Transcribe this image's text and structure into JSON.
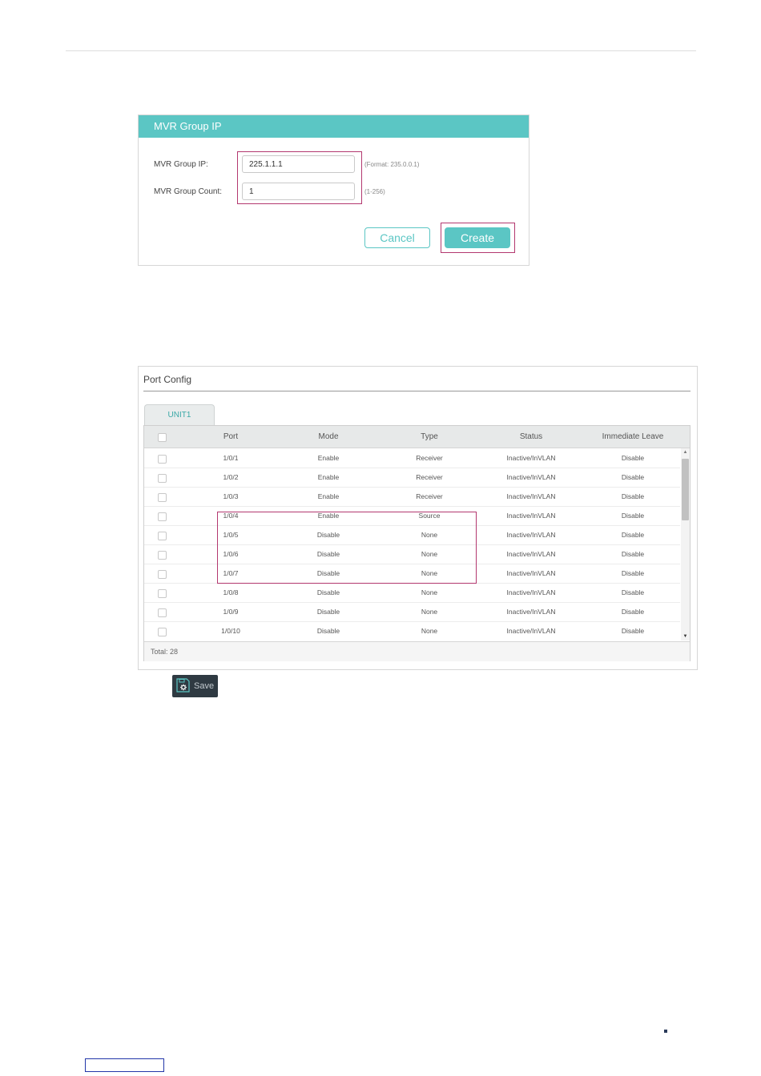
{
  "mvr_panel": {
    "title": "MVR Group IP",
    "fields": [
      {
        "label": "MVR Group IP:",
        "value": "225.1.1.1",
        "hint": "(Format: 235.0.0.1)"
      },
      {
        "label": "MVR Group Count:",
        "value": "1",
        "hint": "(1-256)"
      }
    ],
    "cancel_label": "Cancel",
    "create_label": "Create"
  },
  "port_config": {
    "title": "Port Config",
    "tab": "UNIT1",
    "columns": [
      "Port",
      "Mode",
      "Type",
      "Status",
      "Immediate Leave"
    ],
    "rows": [
      {
        "port": "1/0/1",
        "mode": "Enable",
        "type": "Receiver",
        "status": "Inactive/InVLAN",
        "leave": "Disable"
      },
      {
        "port": "1/0/2",
        "mode": "Enable",
        "type": "Receiver",
        "status": "Inactive/InVLAN",
        "leave": "Disable"
      },
      {
        "port": "1/0/3",
        "mode": "Enable",
        "type": "Receiver",
        "status": "Inactive/InVLAN",
        "leave": "Disable"
      },
      {
        "port": "1/0/4",
        "mode": "Enable",
        "type": "Source",
        "status": "Inactive/InVLAN",
        "leave": "Disable"
      },
      {
        "port": "1/0/5",
        "mode": "Disable",
        "type": "None",
        "status": "Inactive/InVLAN",
        "leave": "Disable"
      },
      {
        "port": "1/0/6",
        "mode": "Disable",
        "type": "None",
        "status": "Inactive/InVLAN",
        "leave": "Disable"
      },
      {
        "port": "1/0/7",
        "mode": "Disable",
        "type": "None",
        "status": "Inactive/InVLAN",
        "leave": "Disable"
      },
      {
        "port": "1/0/8",
        "mode": "Disable",
        "type": "None",
        "status": "Inactive/InVLAN",
        "leave": "Disable"
      },
      {
        "port": "1/0/9",
        "mode": "Disable",
        "type": "None",
        "status": "Inactive/InVLAN",
        "leave": "Disable"
      },
      {
        "port": "1/0/10",
        "mode": "Disable",
        "type": "None",
        "status": "Inactive/InVLAN",
        "leave": "Disable"
      }
    ],
    "total": "Total: 28"
  },
  "save_label": "Save",
  "icons": {
    "save": "save-gear-icon",
    "scroll_up": "scroll-up-arrow-icon",
    "scroll_down": "scroll-down-arrow-icon"
  },
  "colors": {
    "accent": "#5bc6c4",
    "highlight": "#b3386f",
    "save_bg": "#2f3a42"
  }
}
